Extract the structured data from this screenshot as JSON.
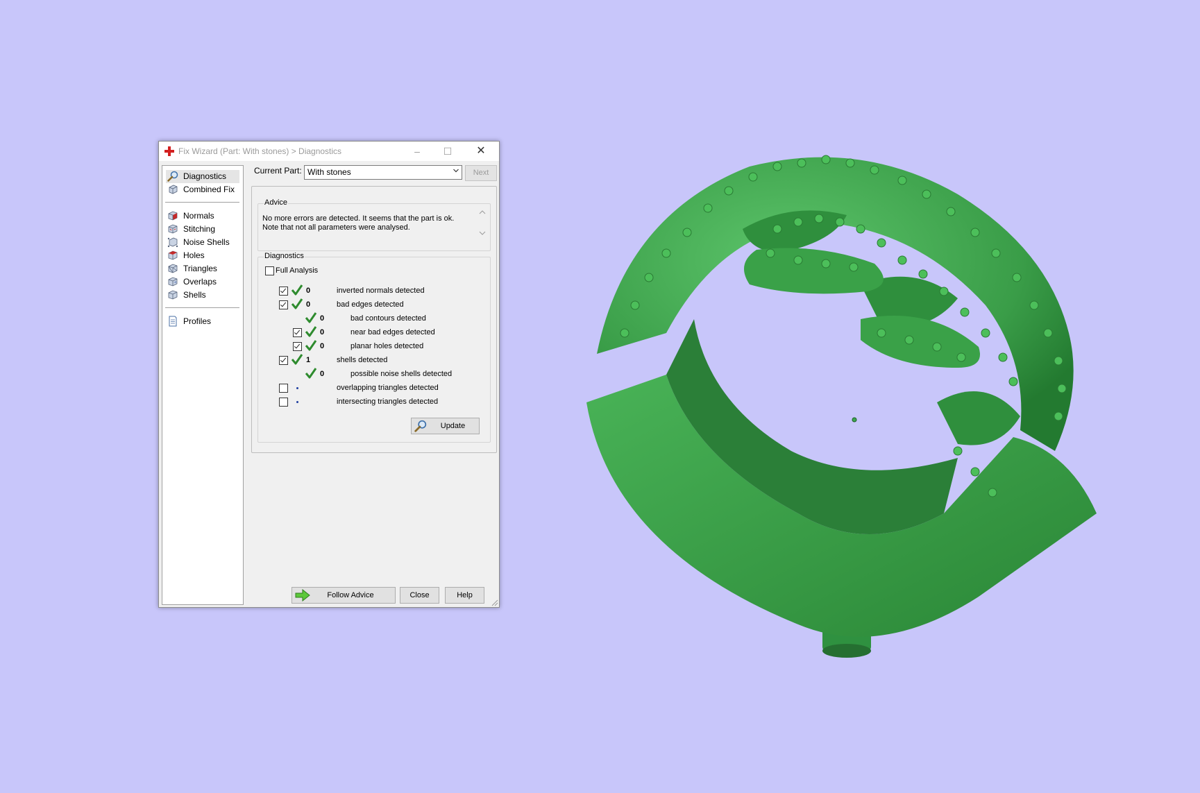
{
  "window": {
    "title": "Fix Wizard (Part: With stones) > Diagnostics",
    "minimize_glyph": "–",
    "maximize_glyph": "☐",
    "close_glyph": "✕"
  },
  "nav": {
    "items": [
      {
        "label": "Diagnostics",
        "icon": "magnifier-icon"
      },
      {
        "label": "Combined Fix",
        "icon": "cube-icon"
      },
      {
        "label": "Normals",
        "icon": "normals-cube-icon"
      },
      {
        "label": "Stitching",
        "icon": "stitching-cube-icon"
      },
      {
        "label": "Noise Shells",
        "icon": "noise-shells-icon"
      },
      {
        "label": "Holes",
        "icon": "holes-cube-icon"
      },
      {
        "label": "Triangles",
        "icon": "triangles-cube-icon"
      },
      {
        "label": "Overlaps",
        "icon": "overlaps-cube-icon"
      },
      {
        "label": "Shells",
        "icon": "shells-cube-icon"
      },
      {
        "label": "Profiles",
        "icon": "document-icon"
      }
    ]
  },
  "current_part": {
    "label": "Current Part:",
    "value": "With stones",
    "next_label": "Next"
  },
  "advice": {
    "title": "Advice",
    "text_line1": "No more errors are detected. It seems that the part is ok.",
    "text_line2": "Note that not all parameters were analysed."
  },
  "diagnostics": {
    "title": "Diagnostics",
    "full_analysis_label": "Full Analysis",
    "full_analysis_checked": false,
    "rows": [
      {
        "checked": true,
        "count": "0",
        "label": "inverted normals detected"
      },
      {
        "checked": true,
        "count": "0",
        "label": "bad edges detected"
      },
      {
        "checked": null,
        "count": "0",
        "label": "bad contours detected"
      },
      {
        "checked": true,
        "count": "0",
        "label": "near bad edges detected"
      },
      {
        "checked": true,
        "count": "0",
        "label": "planar holes detected"
      },
      {
        "checked": true,
        "count": "1",
        "label": "shells detected"
      },
      {
        "checked": null,
        "count": "0",
        "label": "possible noise shells detected"
      },
      {
        "checked": false,
        "count": "",
        "label": "overlapping triangles detected"
      },
      {
        "checked": false,
        "count": "",
        "label": "intersecting triangles detected"
      }
    ],
    "update_label": "Update"
  },
  "footer": {
    "follow_advice_label": "Follow Advice",
    "close_label": "Close",
    "help_label": "Help"
  },
  "colors": {
    "background": "#c8c6fa",
    "model_green": "#3ea650",
    "check_green": "#2e8b2e"
  }
}
